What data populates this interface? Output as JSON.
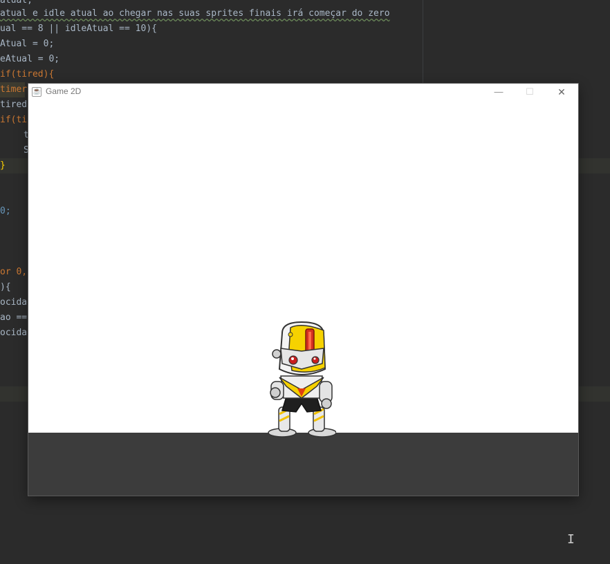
{
  "editor": {
    "lines": [
      "atual e idle atual ao chegar nas suas sprites finais irá começar do zero",
      "ual == 8 || idleAtual == 10){",
      "Atual = 0;",
      "eAtual = 0;",
      "if(tired){",
      "timer",
      "tired",
      "if(ti",
      "t",
      "S",
      "}",
      "0;",
      "or 0,",
      "){",
      "ocidad",
      "ao ==",
      "ocidad"
    ],
    "colors": {
      "background": "#2b2b2b",
      "text": "#a9b7c6",
      "keyword": "#cc7832",
      "number": "#6897bb"
    }
  },
  "window": {
    "title": "Game 2D",
    "icon": "java-icon",
    "controls": {
      "minimize": "—",
      "maximize": "☐",
      "close": "✕"
    }
  },
  "game": {
    "background": "#ffffff",
    "ground_color": "#3c3c3c",
    "player": "robot-sprite"
  }
}
